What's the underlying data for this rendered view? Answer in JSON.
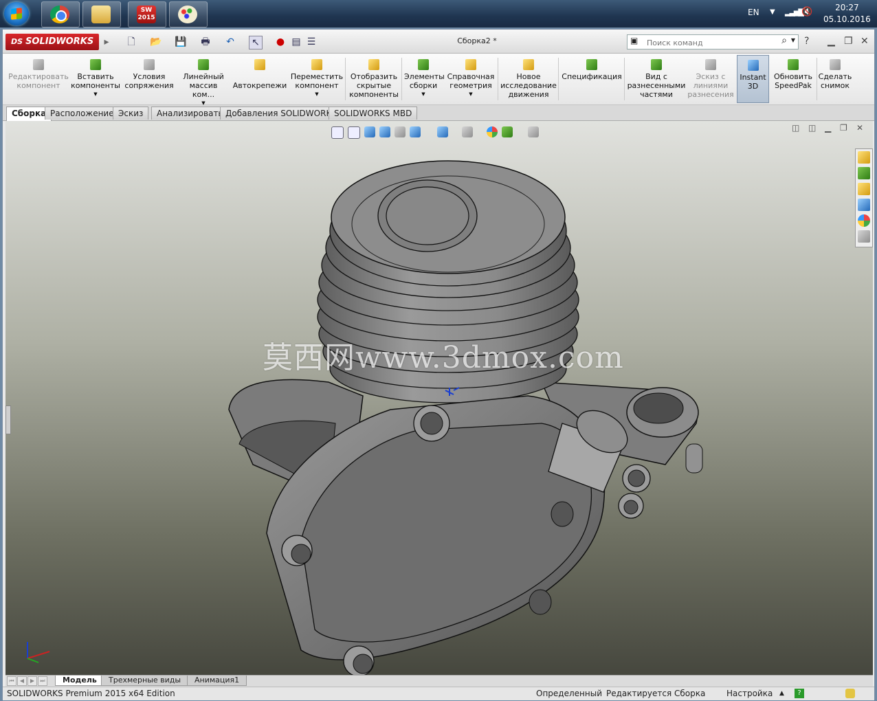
{
  "taskbar": {
    "apps": [
      {
        "icon": "chrome-icon"
      },
      {
        "icon": "explorer-icon"
      },
      {
        "icon": "solidworks-icon",
        "label": "SW\n2015"
      },
      {
        "icon": "paint-icon"
      }
    ],
    "language": "EN",
    "time": "20:27",
    "date": "05.10.2016"
  },
  "app": {
    "brand": "SOLIDWORKS",
    "document_title": "Сборка2 *",
    "search_placeholder": "Поиск команд",
    "help": "?"
  },
  "ribbon": {
    "buttons": [
      {
        "label": "Редактировать компонент",
        "disabled": true
      },
      {
        "label": "Вставить компоненты"
      },
      {
        "label": "Условия сопряжения"
      },
      {
        "label": "Линейный массив ком..."
      },
      {
        "label": "Автокрепежи"
      },
      {
        "label": "Переместить компонент"
      },
      {
        "label": "Отобразить скрытые компоненты"
      },
      {
        "label": "Элементы сборки"
      },
      {
        "label": "Справочная геометрия"
      },
      {
        "label": "Новое исследование движения"
      },
      {
        "label": "Спецификация"
      },
      {
        "label": "Вид с разнесенными частями"
      },
      {
        "label": "Эскиз с линиями разнесения",
        "disabled": true
      },
      {
        "label": "Instant 3D",
        "active": true
      },
      {
        "label": "Обновить SpeedPak"
      },
      {
        "label": "Сделать снимок"
      }
    ]
  },
  "command_tabs": [
    "Сборка",
    "Расположение",
    "Эскиз",
    "Анализировать",
    "Добавления SOLIDWORKS",
    "SOLIDWORKS MBD"
  ],
  "active_command_tab": "Сборка",
  "viewport": {
    "watermark": "莫西网www.3dmox.com",
    "colors": {
      "background_top": "#e1e2de",
      "background_bottom": "#46473e",
      "model": "#8a8a8a"
    }
  },
  "bottom_tabs": [
    "Модель",
    "Трехмерные виды",
    "Анимация1"
  ],
  "active_bottom_tab": "Модель",
  "status_bar": {
    "product": "SOLIDWORKS Premium 2015 x64 Edition",
    "state": "Определенный",
    "mode": "Редактируется Сборка",
    "settings": "Настройка"
  }
}
